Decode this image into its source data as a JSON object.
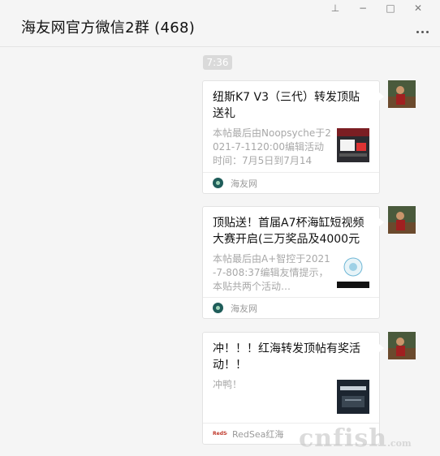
{
  "window": {
    "title": "海友网官方微信2群 (468)",
    "controls": {
      "pin": "⊥",
      "minimize": "−",
      "maximize": "□",
      "close": "✕"
    }
  },
  "timestamp": "7:36",
  "messages": [
    {
      "title": "纽斯K7 V3（三代）转发顶贴送礼",
      "description": "本帖最后由Noopsyche于2021-7-1120:00编辑活动时间：7月5日到7月14日…",
      "source": "海友网",
      "thumb_icon": "product-thumbnail-icon"
    },
    {
      "title": "顶贴送！首届A7杯海缸短视频大赛开启(三万奖品及4000元现金)",
      "description": "本帖最后由A+智控于2021-7-808:37编辑友情提示，本贴共两个活动…",
      "source": "海友网",
      "thumb_icon": "contest-thumbnail-icon"
    },
    {
      "title": "冲！！！红海转发顶帖有奖活动！！",
      "description": "冲鸭！",
      "source": "RedSea红海",
      "source_logo_text": "RedSea",
      "thumb_icon": "redsea-thumbnail-icon"
    }
  ],
  "watermark": {
    "main": "cnfish",
    "suffix": ".com"
  },
  "colors": {
    "background": "#f5f5f5",
    "card": "#ffffff",
    "time_pill": "#dadada",
    "source_logo": "#1f5d5a"
  }
}
